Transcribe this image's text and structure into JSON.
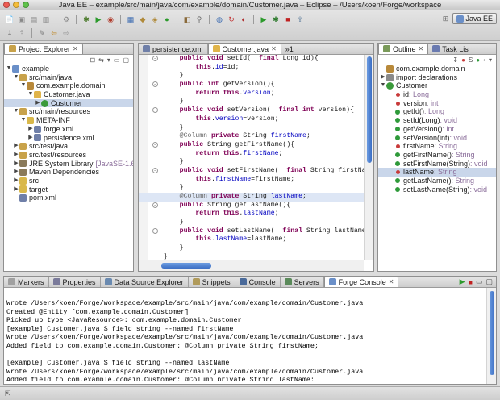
{
  "window": {
    "title": "Java EE – example/src/main/java/com/example/domain/Customer.java – Eclipse – /Users/koen/Forge/workspace"
  },
  "perspective": {
    "label": "Java EE"
  },
  "explorer": {
    "tab_label": "Project Explorer",
    "items": [
      {
        "label": "example",
        "depth": 0,
        "twisty": "▼",
        "icon": "project-icon",
        "color": "#6a8fc8"
      },
      {
        "label": "src/main/java",
        "depth": 1,
        "twisty": "▼",
        "icon": "source-folder-icon",
        "color": "#c8a24a"
      },
      {
        "label": "com.example.domain",
        "depth": 2,
        "twisty": "▼",
        "icon": "package-icon",
        "color": "#b8893a"
      },
      {
        "label": "Customer.java",
        "depth": 3,
        "twisty": "▼",
        "icon": "java-file-icon",
        "color": "#e0b44a"
      },
      {
        "label": "Customer",
        "depth": 4,
        "twisty": "▶",
        "icon": "class-icon",
        "color": "#3b9a3b",
        "selected": true
      },
      {
        "label": "src/main/resources",
        "depth": 1,
        "twisty": "▼",
        "icon": "source-folder-icon",
        "color": "#c8a24a"
      },
      {
        "label": "META-INF",
        "depth": 2,
        "twisty": "▼",
        "icon": "folder-icon",
        "color": "#d9b84a"
      },
      {
        "label": "forge.xml",
        "depth": 3,
        "twisty": "▶",
        "icon": "xml-file-icon",
        "color": "#6f7fa8"
      },
      {
        "label": "persistence.xml",
        "depth": 3,
        "twisty": "▶",
        "icon": "xml-file-icon",
        "color": "#6f7fa8"
      },
      {
        "label": "src/test/java",
        "depth": 1,
        "twisty": "▶",
        "icon": "source-folder-icon",
        "color": "#c8a24a"
      },
      {
        "label": "src/test/resources",
        "depth": 1,
        "twisty": "▶",
        "icon": "source-folder-icon",
        "color": "#c8a24a"
      },
      {
        "label": "JRE System Library",
        "suffix": "[JavaSE-1.6]",
        "depth": 1,
        "twisty": "▶",
        "icon": "library-icon",
        "color": "#8a7a5a"
      },
      {
        "label": "Maven Dependencies",
        "depth": 1,
        "twisty": "▶",
        "icon": "library-icon",
        "color": "#8a7a5a"
      },
      {
        "label": "src",
        "depth": 1,
        "twisty": "▶",
        "icon": "folder-icon",
        "color": "#d9b84a"
      },
      {
        "label": "target",
        "depth": 1,
        "twisty": "▶",
        "icon": "folder-icon",
        "color": "#d9b84a"
      },
      {
        "label": "pom.xml",
        "depth": 1,
        "twisty": "",
        "icon": "xml-file-icon",
        "color": "#6f7fa8"
      }
    ]
  },
  "editor": {
    "tabs": [
      {
        "label": "persistence.xml"
      },
      {
        "label": "Customer.java"
      }
    ],
    "overflow": "»1",
    "lines": [
      [
        [
          "    ",
          ""
        ],
        [
          "public",
          "kw"
        ],
        [
          " ",
          ""
        ],
        [
          "void",
          "kw"
        ],
        [
          " setId(  ",
          ""
        ],
        [
          "final",
          "kw"
        ],
        [
          " Long id){",
          ""
        ]
      ],
      [
        [
          "        ",
          ""
        ],
        [
          "this",
          "kw"
        ],
        [
          ".",
          ""
        ],
        [
          "id",
          "fld"
        ],
        [
          "=id;",
          ""
        ]
      ],
      [
        [
          "    }",
          ""
        ]
      ],
      [
        [
          "    ",
          ""
        ],
        [
          "public",
          "kw"
        ],
        [
          " ",
          ""
        ],
        [
          "int",
          "kw"
        ],
        [
          " getVersion(){",
          ""
        ]
      ],
      [
        [
          "        ",
          ""
        ],
        [
          "return",
          "kw"
        ],
        [
          " ",
          ""
        ],
        [
          "this",
          "kw"
        ],
        [
          ".",
          ""
        ],
        [
          "version",
          "fld"
        ],
        [
          ";",
          ""
        ]
      ],
      [
        [
          "    }",
          ""
        ]
      ],
      [
        [
          "    ",
          ""
        ],
        [
          "public",
          "kw"
        ],
        [
          " ",
          ""
        ],
        [
          "void",
          "kw"
        ],
        [
          " setVersion(  ",
          ""
        ],
        [
          "final",
          "kw"
        ],
        [
          " ",
          ""
        ],
        [
          "int",
          "kw"
        ],
        [
          " version){",
          ""
        ]
      ],
      [
        [
          "        ",
          ""
        ],
        [
          "this",
          "kw"
        ],
        [
          ".",
          ""
        ],
        [
          "version",
          "fld"
        ],
        [
          "=version;",
          ""
        ]
      ],
      [
        [
          "    }",
          ""
        ]
      ],
      [
        [
          "    ",
          ""
        ],
        [
          "@Column",
          "ann"
        ],
        [
          " ",
          ""
        ],
        [
          "private",
          "kw"
        ],
        [
          " String ",
          ""
        ],
        [
          "firstName",
          "fld"
        ],
        [
          ";",
          ""
        ]
      ],
      [
        [
          "    ",
          ""
        ],
        [
          "public",
          "kw"
        ],
        [
          " String getFirstName(){",
          ""
        ]
      ],
      [
        [
          "        ",
          ""
        ],
        [
          "return",
          "kw"
        ],
        [
          " ",
          ""
        ],
        [
          "this",
          "kw"
        ],
        [
          ".",
          ""
        ],
        [
          "firstName",
          "fld"
        ],
        [
          ";",
          ""
        ]
      ],
      [
        [
          "    }",
          ""
        ]
      ],
      [
        [
          "    ",
          ""
        ],
        [
          "public",
          "kw"
        ],
        [
          " ",
          ""
        ],
        [
          "void",
          "kw"
        ],
        [
          " setFirstName(  ",
          ""
        ],
        [
          "final",
          "kw"
        ],
        [
          " String firstName){",
          ""
        ]
      ],
      [
        [
          "        ",
          ""
        ],
        [
          "this",
          "kw"
        ],
        [
          ".",
          ""
        ],
        [
          "firstName",
          "fld"
        ],
        [
          "=firstName;",
          ""
        ]
      ],
      [
        [
          "    }",
          ""
        ]
      ],
      [
        [
          "    ",
          ""
        ],
        [
          "@Column",
          "ann"
        ],
        [
          " ",
          ""
        ],
        [
          "private",
          "kw"
        ],
        [
          " String ",
          ""
        ],
        [
          "lastName",
          "fld"
        ],
        [
          ";",
          ""
        ]
      ],
      [
        [
          "    ",
          ""
        ],
        [
          "public",
          "kw"
        ],
        [
          " String getLastName(){",
          ""
        ]
      ],
      [
        [
          "        ",
          ""
        ],
        [
          "return",
          "kw"
        ],
        [
          " ",
          ""
        ],
        [
          "this",
          "kw"
        ],
        [
          ".",
          ""
        ],
        [
          "lastName",
          "fld"
        ],
        [
          ";",
          ""
        ]
      ],
      [
        [
          "    }",
          ""
        ]
      ],
      [
        [
          "    ",
          ""
        ],
        [
          "public",
          "kw"
        ],
        [
          " ",
          ""
        ],
        [
          "void",
          "kw"
        ],
        [
          " setLastName(  ",
          ""
        ],
        [
          "final",
          "kw"
        ],
        [
          " String lastName){",
          ""
        ]
      ],
      [
        [
          "        ",
          ""
        ],
        [
          "this",
          "kw"
        ],
        [
          ".",
          ""
        ],
        [
          "lastName",
          "fld"
        ],
        [
          "=lastName;",
          ""
        ]
      ],
      [
        [
          "    }",
          ""
        ]
      ],
      [
        [
          "}",
          ""
        ]
      ]
    ],
    "highlight_line": 16,
    "fold_lines": [
      0,
      3,
      6,
      10,
      13,
      17,
      20
    ]
  },
  "outline": {
    "tabs": [
      {
        "label": "Outline"
      },
      {
        "label": "Task Lis"
      }
    ],
    "items": [
      {
        "label": "com.example.domain",
        "type": "",
        "depth": 0,
        "twisty": "",
        "icon": "package-icon",
        "color": "#b8893a"
      },
      {
        "label": "import declarations",
        "type": "",
        "depth": 0,
        "twisty": "▶",
        "icon": "imports-icon",
        "color": "#8a8a8a"
      },
      {
        "label": "Customer",
        "type": "",
        "depth": 0,
        "twisty": "▼",
        "icon": "class-icon",
        "color": "#3b9a3b"
      },
      {
        "label": "id",
        "type": " : Long",
        "depth": 1,
        "twisty": "",
        "icon": "private-field-icon",
        "color": "#c83a3a"
      },
      {
        "label": "version",
        "type": " : int",
        "depth": 1,
        "twisty": "",
        "icon": "private-field-icon",
        "color": "#c83a3a"
      },
      {
        "label": "getId()",
        "type": " : Long",
        "depth": 1,
        "twisty": "",
        "icon": "public-method-icon",
        "color": "#2f9a3a"
      },
      {
        "label": "setId(Long)",
        "type": " : void",
        "depth": 1,
        "twisty": "",
        "icon": "public-method-icon",
        "color": "#2f9a3a"
      },
      {
        "label": "getVersion()",
        "type": " : int",
        "depth": 1,
        "twisty": "",
        "icon": "public-method-icon",
        "color": "#2f9a3a"
      },
      {
        "label": "setVersion(int)",
        "type": " : void",
        "depth": 1,
        "twisty": "",
        "icon": "public-method-icon",
        "color": "#2f9a3a"
      },
      {
        "label": "firstName",
        "type": " : String",
        "depth": 1,
        "twisty": "",
        "icon": "private-field-icon",
        "color": "#c83a3a"
      },
      {
        "label": "getFirstName()",
        "type": " : String",
        "depth": 1,
        "twisty": "",
        "icon": "public-method-icon",
        "color": "#2f9a3a"
      },
      {
        "label": "setFirstName(String)",
        "type": " : void",
        "depth": 1,
        "twisty": "",
        "icon": "public-method-icon",
        "color": "#2f9a3a"
      },
      {
        "label": "lastName",
        "type": " : String",
        "depth": 1,
        "twisty": "",
        "icon": "private-field-icon",
        "color": "#c83a3a",
        "selected": true
      },
      {
        "label": "getLastName()",
        "type": " : String",
        "depth": 1,
        "twisty": "",
        "icon": "public-method-icon",
        "color": "#2f9a3a"
      },
      {
        "label": "setLastName(String)",
        "type": " : void",
        "depth": 1,
        "twisty": "",
        "icon": "public-method-icon",
        "color": "#2f9a3a"
      }
    ]
  },
  "bottom": {
    "tabs": [
      {
        "label": "Markers",
        "icon": "markers-icon",
        "color": "#a0a0a0"
      },
      {
        "label": "Properties",
        "icon": "properties-icon",
        "color": "#7a7a9a"
      },
      {
        "label": "Data Source Explorer",
        "icon": "data-source-icon",
        "color": "#6a8ab0"
      },
      {
        "label": "Snippets",
        "icon": "snippets-icon",
        "color": "#b09a5a"
      },
      {
        "label": "Console",
        "icon": "console-icon",
        "color": "#4a6a9a"
      },
      {
        "label": "Servers",
        "icon": "servers-icon",
        "color": "#5a8a5a"
      },
      {
        "label": "Forge Console",
        "icon": "forge-icon",
        "color": "#6a8fc8",
        "active": true
      }
    ],
    "console_lines": [
      "Wrote /Users/koen/Forge/workspace/example/src/main/java/com/example/domain/Customer.java",
      "Created @Entity [com.example.domain.Customer]",
      "Picked up type <JavaResource>: com.example.domain.Customer",
      "[example] Customer.java $ field string --named firstName",
      "Wrote /Users/koen/Forge/workspace/example/src/main/java/com/example/domain/Customer.java",
      "Added field to com.example.domain.Customer: @Column private String firstName;",
      "",
      "[example] Customer.java $ field string --named lastName",
      "Wrote /Users/koen/Forge/workspace/example/src/main/java/com/example/domain/Customer.java",
      "Added field to com.example.domain.Customer: @Column private String lastName;",
      "",
      "[example] Customer.java $"
    ]
  }
}
